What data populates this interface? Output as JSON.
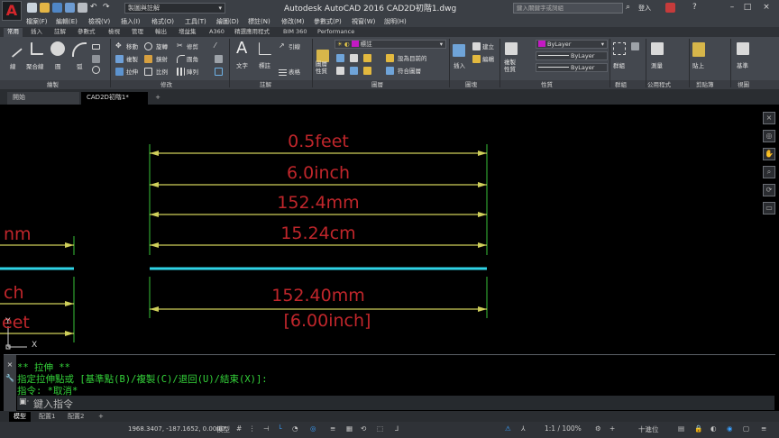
{
  "app": {
    "logo": "A",
    "window_title": "Autodesk AutoCAD 2016   CAD2D初階1.dwg",
    "workspace": "製圖與註解",
    "search_placeholder": "鍵入關鍵字或詞組",
    "signin": "登入"
  },
  "menu": [
    "檔案(F)",
    "編輯(E)",
    "檢視(V)",
    "插入(I)",
    "格式(O)",
    "工具(T)",
    "繪圖(D)",
    "標註(N)",
    "修改(M)",
    "參數式(P)",
    "視窗(W)",
    "說明(H)"
  ],
  "ribbon_tabs": [
    "常用",
    "插入",
    "註解",
    "參數式",
    "檢視",
    "管理",
    "輸出",
    "增益集",
    "A360",
    "精選應用程式",
    "BIM 360",
    "Performance"
  ],
  "ribbon": {
    "draw": {
      "line": "線",
      "polyline": "聚合線",
      "circle": "圓",
      "arc": "弧",
      "panel": "繪製"
    },
    "modify": {
      "move": "移動",
      "rotate": "旋轉",
      "trim": "修剪",
      "copy": "複製",
      "mirror": "鏡射",
      "fillet": "圓角",
      "stretch": "拉伸",
      "scale": "比例",
      "array": "陣列",
      "panel": "修改"
    },
    "annotation": {
      "text": "文字",
      "dimension": "標註",
      "leader": "引線",
      "table": "表格",
      "panel": "註解"
    },
    "layers": {
      "layer_props": "圖層性質",
      "current_layer": "標註",
      "make_current": "設為目前的",
      "match": "符合圖層",
      "panel": "圖層"
    },
    "block": {
      "insert": "插入",
      "create": "建立",
      "edit": "編輯",
      "panel": "圖塊"
    },
    "properties": {
      "match": "複製性質",
      "color": "ByLayer",
      "linetype": "ByLayer",
      "lineweight": "ByLayer",
      "panel": "性質"
    },
    "groups": {
      "group": "群組",
      "panel": "群組"
    },
    "utilities": {
      "measure": "測量",
      "panel": "公用程式"
    },
    "clipboard": {
      "paste": "貼上",
      "panel": "剪貼簿"
    },
    "view": {
      "base": "基準",
      "panel": "視圖"
    }
  },
  "file_tabs": {
    "start": "開始",
    "drawing": "CAD2D初階1*",
    "add": "+"
  },
  "canvas": {
    "dim_labels_right": [
      "0.5feet",
      "6.0inch",
      "152.4mm",
      "15.24cm"
    ],
    "dim_labels_below": [
      "152.40mm",
      "[6.00inch]"
    ],
    "dim_labels_left": [
      "nm",
      "ch",
      "eet"
    ],
    "ucs_x": "X",
    "ucs_y": "Y"
  },
  "command": {
    "history": [
      "** 拉伸 **",
      "指定拉伸點或 [基準點(B)/複製(C)/退回(U)/結束(X)]:",
      "指令: *取消*"
    ],
    "placeholder": "鍵入指令"
  },
  "layout_tabs": [
    "模型",
    "配置1",
    "配置2",
    "+"
  ],
  "status": {
    "coords": "1968.3407, -187.1652, 0.0000",
    "model": "模型",
    "scale": "1:1 / 100%",
    "decimal": "十進位"
  },
  "colors": {
    "dimension_line": "#cfcf5a",
    "dimension_text": "#c0262b",
    "object_line": "#2fd3e6",
    "extension_line": "#39c239",
    "command_text": "#34d33a",
    "swatch_layer": "#c419c4"
  }
}
